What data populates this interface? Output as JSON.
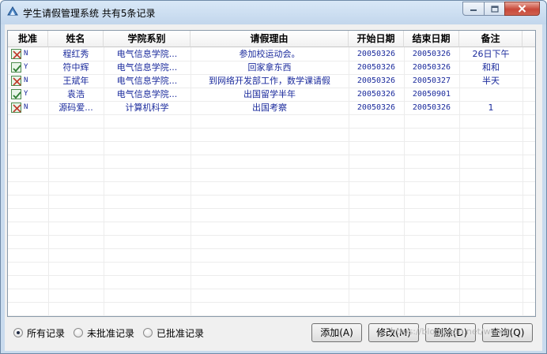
{
  "window": {
    "title": "学生请假管理系统  共有5条记录",
    "icons": {
      "app": "student-app-icon",
      "minimize": "minimize-icon",
      "maximize": "maximize-icon",
      "close": "close-icon"
    }
  },
  "table": {
    "columns": [
      "批准",
      "姓名",
      "学院系别",
      "请假理由",
      "开始日期",
      "结束日期",
      "备注"
    ],
    "rows": [
      {
        "approved": "N",
        "approve_icon": "checkbox-rejected-icon",
        "name": "程红秀",
        "department": "电气信息学院...",
        "reason": "参加校运动会。",
        "start": "20050326",
        "end": "20050326",
        "note": "26日下午"
      },
      {
        "approved": "Y",
        "approve_icon": "checkbox-approved-icon",
        "name": "符中辉",
        "department": "电气信息学院...",
        "reason": "回家拿东西",
        "start": "20050326",
        "end": "20050326",
        "note": "和和"
      },
      {
        "approved": "N",
        "approve_icon": "checkbox-rejected-icon",
        "name": "王斌年",
        "department": "电气信息学院...",
        "reason": "到网络开发部工作，数学课请假",
        "start": "20050326",
        "end": "20050327",
        "note": "半天"
      },
      {
        "approved": "Y",
        "approve_icon": "checkbox-approved-icon",
        "name": "袁浩",
        "department": "电气信息学院...",
        "reason": "出国留学半年",
        "start": "20050326",
        "end": "20050901",
        "note": ""
      },
      {
        "approved": "N",
        "approve_icon": "checkbox-rejected-icon",
        "name": "源码爱...",
        "department": "计算机科学",
        "reason": "出国考察",
        "start": "20050326",
        "end": "20050326",
        "note": "1"
      }
    ]
  },
  "filters": {
    "options": [
      "所有记录",
      "未批准记录",
      "已批准记录"
    ],
    "selected": "所有记录"
  },
  "buttons": {
    "add": "添加(A)",
    "modify": "修改(M)",
    "delete": "删除(D)",
    "query": "查询(Q)"
  },
  "watermark": "https://blog.csdn.net/weixin..."
}
